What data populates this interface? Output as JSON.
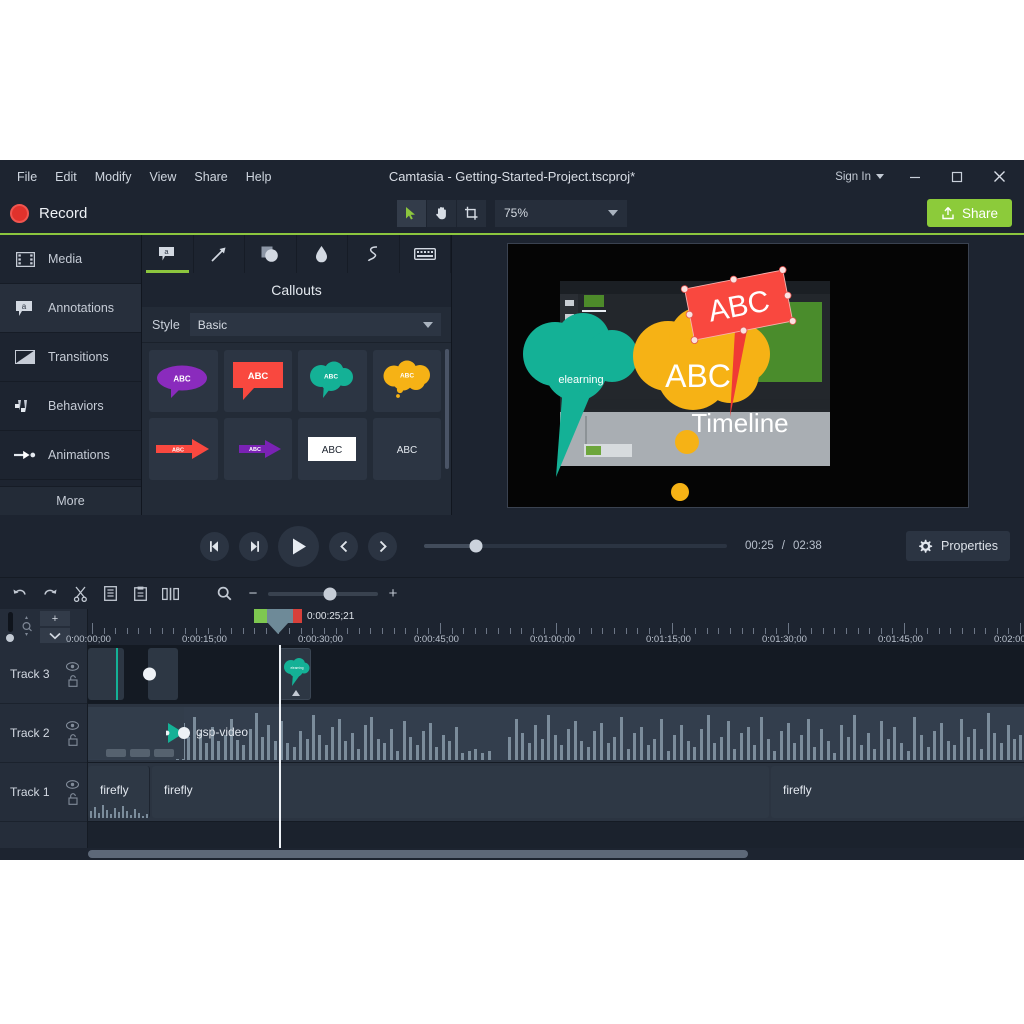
{
  "window": {
    "title": "Camtasia - Getting-Started-Project.tscproj*",
    "sign_in": "Sign In",
    "minimize": "–",
    "maximize": "□",
    "close": "✕"
  },
  "menubar": {
    "items": [
      "File",
      "Edit",
      "Modify",
      "View",
      "Share",
      "Help"
    ]
  },
  "toolbar": {
    "record_label": "Record",
    "share_label": "Share",
    "zoom_value": "75%",
    "tools": [
      {
        "name": "pointer-tool",
        "glyph": "➤"
      },
      {
        "name": "hand-tool",
        "glyph": "✋"
      },
      {
        "name": "crop-tool",
        "glyph": "⌗"
      }
    ]
  },
  "rail": {
    "items": [
      {
        "label": "Media",
        "icon": "film-icon"
      },
      {
        "label": "Annotations",
        "icon": "callout-icon"
      },
      {
        "label": "Transitions",
        "icon": "transition-icon"
      },
      {
        "label": "Behaviors",
        "icon": "behaviors-icon"
      },
      {
        "label": "Animations",
        "icon": "animations-icon"
      }
    ],
    "more_label": "More"
  },
  "library": {
    "tabs": [
      {
        "name": "tab-callouts",
        "icon": "speech-bubble-icon",
        "active": true
      },
      {
        "name": "tab-arrows",
        "icon": "arrow-icon",
        "active": false
      },
      {
        "name": "tab-shapes",
        "icon": "shapes-icon",
        "active": false
      },
      {
        "name": "tab-blur",
        "icon": "blur-drop-icon",
        "active": false
      },
      {
        "name": "tab-sketch",
        "icon": "sketch-squiggle-icon",
        "active": false
      },
      {
        "name": "tab-keystroke",
        "icon": "keyboard-icon",
        "active": false
      }
    ],
    "title": "Callouts",
    "style_label": "Style",
    "style_value": "Basic",
    "thumbnails": [
      {
        "name": "callout-purple-bubble",
        "text": "ABC",
        "color": "#8a2bbd",
        "shape": "rounded-bubble"
      },
      {
        "name": "callout-red-rect",
        "text": "ABC",
        "color": "#f9483f",
        "shape": "rect-bubble"
      },
      {
        "name": "callout-teal-cloud",
        "text": "ABC",
        "color": "#14b196",
        "shape": "cloud"
      },
      {
        "name": "callout-orange-thought",
        "text": "ABC",
        "color": "#f6b215",
        "shape": "thought-cloud"
      },
      {
        "name": "callout-red-arrow",
        "text": "ABC",
        "color": "#f9483f",
        "shape": "arrow"
      },
      {
        "name": "callout-purple-arrow",
        "text": "ABC",
        "color": "#7a22b5",
        "shape": "arrow"
      },
      {
        "name": "callout-white-box",
        "text": "ABC",
        "color": "#ffffff",
        "shape": "solid-box"
      },
      {
        "name": "callout-plain-text",
        "text": "ABC",
        "color": "transparent",
        "shape": "text"
      }
    ]
  },
  "canvas": {
    "teal_callout_text": "elearning",
    "orange_callout_text": "ABC",
    "red_callout_text": "ABC",
    "timeline_text": "Timeline"
  },
  "playback": {
    "buttons": [
      {
        "name": "previous-frame-button",
        "glyph": "◀|"
      },
      {
        "name": "next-frame-button",
        "glyph": "|▶"
      },
      {
        "name": "play-button",
        "glyph": "▶"
      },
      {
        "name": "prev-marker-button",
        "glyph": "‹"
      },
      {
        "name": "next-marker-button",
        "glyph": "›"
      }
    ],
    "current_time": "00:25",
    "separator": "/",
    "total_time": "02:38",
    "properties_label": "Properties"
  },
  "timeline_toolbar": {
    "icons": [
      {
        "name": "undo-icon",
        "glyph": "↶"
      },
      {
        "name": "redo-icon",
        "glyph": "↷"
      },
      {
        "name": "cut-icon",
        "glyph": "✂"
      },
      {
        "name": "copy-icon",
        "glyph": "☰"
      },
      {
        "name": "paste-icon",
        "glyph": "⎇"
      },
      {
        "name": "split-icon",
        "glyph": "◫"
      }
    ],
    "zoom_search_icon": "magnifier-icon",
    "zoom_out": "−",
    "zoom_in": "+"
  },
  "timeline": {
    "playhead_time": "0:00:25;21",
    "ruler_labels": [
      "0:00:00;00",
      "0:00:15;00",
      "0:00:30;00",
      "0:00:45;00",
      "0:01:00;00",
      "0:01:15;00",
      "0:01:30;00",
      "0:01:45;00",
      "0:02:00"
    ],
    "add_track_button": "+",
    "collapse_tracks_button": "⌄",
    "tracks": [
      {
        "name": "Track 3",
        "eye_icon": "eye-icon",
        "lock_icon": "lock-icon"
      },
      {
        "name": "Track 2",
        "eye_icon": "eye-icon",
        "lock_icon": "lock-icon"
      },
      {
        "name": "Track 1",
        "eye_icon": "eye-icon",
        "lock_icon": "lock-icon"
      }
    ],
    "clips": {
      "track2_label": "gsp-video",
      "track1_label_a": "firefly",
      "track1_label_b": "firefly",
      "track1_label_c": "firefly"
    }
  },
  "colors": {
    "accent_green": "#8cc63e",
    "share_green": "#8ccb3a",
    "record_red": "#e0322c",
    "panel_bg": "#232b37",
    "app_bg": "#1d2430",
    "teal": "#14b196",
    "orange": "#f6b215",
    "red": "#f9483f"
  }
}
